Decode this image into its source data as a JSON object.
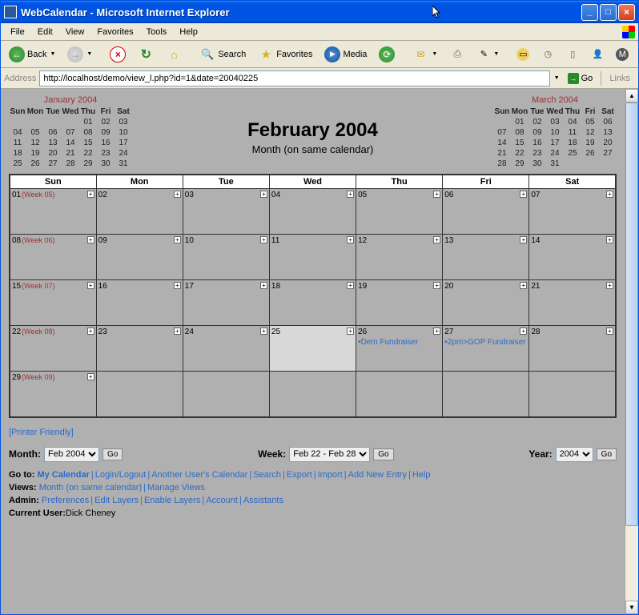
{
  "window": {
    "title": "WebCalendar - Microsoft Internet Explorer"
  },
  "menu": {
    "items": [
      "File",
      "Edit",
      "View",
      "Favorites",
      "Tools",
      "Help"
    ]
  },
  "toolbar": {
    "back": "Back",
    "search": "Search",
    "favorites": "Favorites",
    "media": "Media"
  },
  "address": {
    "label": "Address",
    "url": "http://localhost/demo/view_l.php?id=1&date=20040225",
    "go": "Go",
    "links": "Links"
  },
  "minical_prev": {
    "title": "January 2004",
    "dow": [
      "Sun",
      "Mon",
      "Tue",
      "Wed",
      "Thu",
      "Fri",
      "Sat"
    ],
    "weeks": [
      [
        "",
        "",
        "",
        "",
        "01",
        "02",
        "03"
      ],
      [
        "04",
        "05",
        "06",
        "07",
        "08",
        "09",
        "10"
      ],
      [
        "11",
        "12",
        "13",
        "14",
        "15",
        "16",
        "17"
      ],
      [
        "18",
        "19",
        "20",
        "21",
        "22",
        "23",
        "24"
      ],
      [
        "25",
        "26",
        "27",
        "28",
        "29",
        "30",
        "31"
      ]
    ]
  },
  "minical_next": {
    "title": "March 2004",
    "dow": [
      "Sun",
      "Mon",
      "Tue",
      "Wed",
      "Thu",
      "Fri",
      "Sat"
    ],
    "weeks": [
      [
        "",
        "01",
        "02",
        "03",
        "04",
        "05",
        "06"
      ],
      [
        "07",
        "08",
        "09",
        "10",
        "11",
        "12",
        "13"
      ],
      [
        "14",
        "15",
        "16",
        "17",
        "18",
        "19",
        "20"
      ],
      [
        "21",
        "22",
        "23",
        "24",
        "25",
        "26",
        "27"
      ],
      [
        "28",
        "29",
        "30",
        "31",
        "",
        "",
        ""
      ]
    ]
  },
  "main": {
    "title": "February 2004",
    "subtitle": "Month (on same calendar)"
  },
  "dow": [
    "Sun",
    "Mon",
    "Tue",
    "Wed",
    "Thu",
    "Fri",
    "Sat"
  ],
  "grid": [
    [
      {
        "d": "01",
        "wk": "(Week 05)"
      },
      {
        "d": "02"
      },
      {
        "d": "03"
      },
      {
        "d": "04"
      },
      {
        "d": "05"
      },
      {
        "d": "06"
      },
      {
        "d": "07"
      }
    ],
    [
      {
        "d": "08",
        "wk": "(Week 06)"
      },
      {
        "d": "09"
      },
      {
        "d": "10"
      },
      {
        "d": "11"
      },
      {
        "d": "12"
      },
      {
        "d": "13"
      },
      {
        "d": "14"
      }
    ],
    [
      {
        "d": "15",
        "wk": "(Week 07)"
      },
      {
        "d": "16"
      },
      {
        "d": "17"
      },
      {
        "d": "18"
      },
      {
        "d": "19"
      },
      {
        "d": "20"
      },
      {
        "d": "21"
      }
    ],
    [
      {
        "d": "22",
        "wk": "(Week 08)"
      },
      {
        "d": "23"
      },
      {
        "d": "24"
      },
      {
        "d": "25",
        "today": true
      },
      {
        "d": "26",
        "events": [
          "Dem Fundraiser"
        ]
      },
      {
        "d": "27",
        "events": [
          "2pm>GOP Fundraiser"
        ]
      },
      {
        "d": "28"
      }
    ],
    [
      {
        "d": "29",
        "wk": "(Week 09)"
      },
      null,
      null,
      null,
      null,
      null,
      null
    ]
  ],
  "printer": "[Printer Friendly]",
  "nav": {
    "month_label": "Month:",
    "month_value": "Feb 2004",
    "week_label": "Week:",
    "week_value": "Feb 22 - Feb 28",
    "year_label": "Year:",
    "year_value": "2004",
    "go": "Go"
  },
  "footer": {
    "goto_label": "Go to:",
    "goto_links": [
      "My Calendar",
      "Login/Logout",
      "Another User's Calendar",
      "Search",
      "Export",
      "Import",
      "Add New Entry",
      "Help"
    ],
    "views_label": "Views:",
    "views_links": [
      "Month (on same calendar)",
      "Manage Views"
    ],
    "admin_label": "Admin:",
    "admin_links": [
      "Preferences",
      "Edit Layers",
      "Enable Layers",
      "Account",
      "Assistants"
    ],
    "user_label": "Current User:",
    "user_value": "Dick Cheney"
  }
}
